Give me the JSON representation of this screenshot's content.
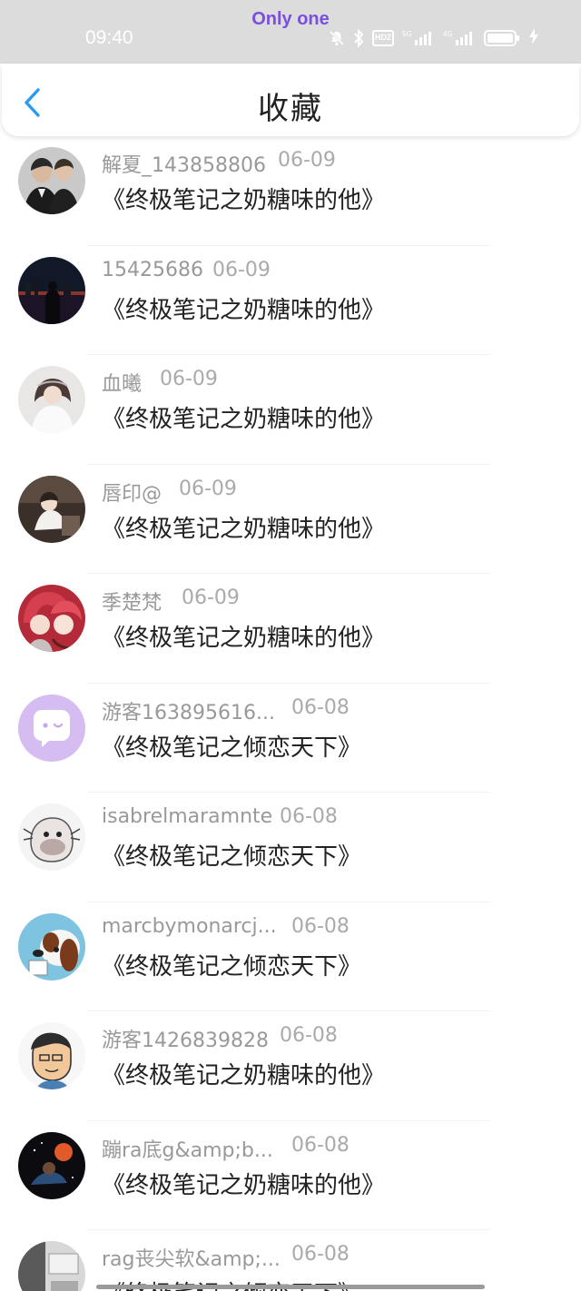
{
  "status_bar": {
    "carrier": "Only one",
    "time": "09:40",
    "hd_label": "HD2",
    "icons": [
      "mute-icon",
      "bluetooth-icon",
      "hd-icon",
      "signal-5g-icon",
      "signal-4g-icon",
      "battery-icon",
      "charging-icon"
    ]
  },
  "header": {
    "title": "收藏",
    "back_icon": "chevron-left-icon",
    "accent_color": "#2a9bf4"
  },
  "items": [
    {
      "name": "解夏_143858806",
      "date": "06-09",
      "title": "《终极笔记之奶糖味的他》",
      "avatar": "avatar-two-men"
    },
    {
      "name": "15425686",
      "date": "06-09",
      "title": "《终极笔记之奶糖味的他》",
      "avatar": "avatar-night-city"
    },
    {
      "name": "血曦",
      "date": "06-09",
      "title": "《终极笔记之奶糖味的他》",
      "avatar": "avatar-girl-white-dress"
    },
    {
      "name": "唇印@",
      "date": "06-09",
      "title": "《终极笔记之奶糖味的他》",
      "avatar": "avatar-sitting-child"
    },
    {
      "name": "季楚梵",
      "date": "06-09",
      "title": "《终极笔记之奶糖味的他》",
      "avatar": "avatar-red-hat-girls"
    },
    {
      "name": "游客163895616...",
      "date": "06-08",
      "title": "《终极笔记之倾恋天下》",
      "avatar": "avatar-default-chat"
    },
    {
      "name": "isabrelmaramnte",
      "date": "06-08",
      "title": "《终极笔记之倾恋天下》",
      "avatar": "avatar-cartoon-face"
    },
    {
      "name": "marcbymonarcj...",
      "date": "06-08",
      "title": "《终极笔记之倾恋天下》",
      "avatar": "avatar-dog"
    },
    {
      "name": "游客1426839828",
      "date": "06-08",
      "title": "《终极笔记之奶糖味的他》",
      "avatar": "avatar-cartoon-man"
    },
    {
      "name": "蹦ra底g&amp;b...",
      "date": "06-08",
      "title": "《终极笔记之奶糖味的他》",
      "avatar": "avatar-dark-scene"
    },
    {
      "name": "rag丧尖软&amp;...",
      "date": "06-08",
      "title": "《终极笔记之倾恋天下》",
      "avatar": "avatar-room"
    }
  ]
}
